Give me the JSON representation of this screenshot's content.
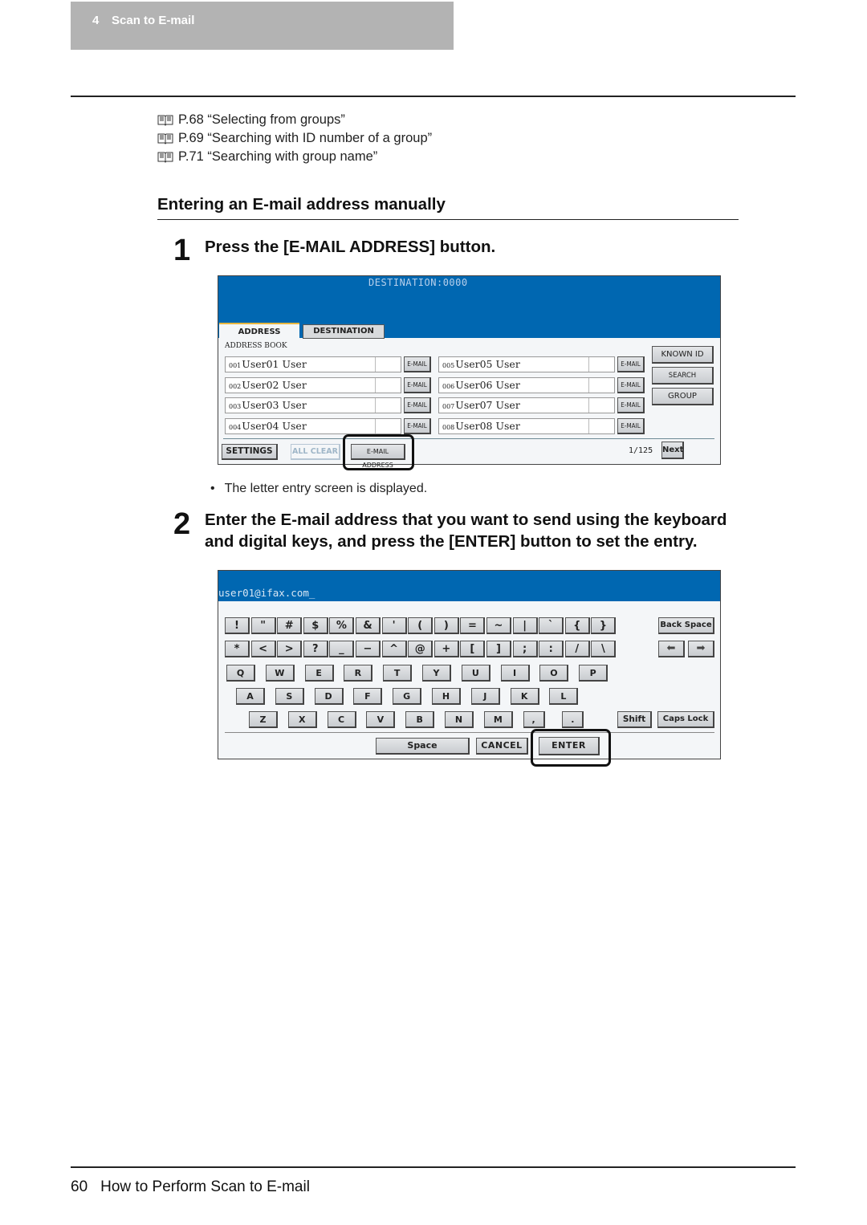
{
  "header": {
    "chapter_number": "4",
    "chapter_title": "Scan to E-mail"
  },
  "references": [
    {
      "icon": "book-icon",
      "text": "P.68 “Selecting from groups”"
    },
    {
      "icon": "book-icon",
      "text": "P.69 “Searching with ID number of a group”"
    },
    {
      "icon": "book-icon",
      "text": "P.71 “Searching with group name”"
    }
  ],
  "section_title": "Entering an E-mail address manually",
  "steps": [
    {
      "number": "1",
      "text": "Press the [E-MAIL ADDRESS] button."
    },
    {
      "number": "2",
      "text_line1": "Enter the E-mail address that you want to send using the keyboard",
      "text_line2": "and digital keys, and press the [ENTER] button to set the entry."
    }
  ],
  "step1_note": "The letter entry screen is displayed.",
  "screen1": {
    "header_text": "DESTINATION:0000",
    "tabs": [
      "ADDRESS",
      "DESTINATION"
    ],
    "address_book_label": "ADDRESS BOOK",
    "entries": [
      {
        "id": "001",
        "name": "User01 User"
      },
      {
        "id": "002",
        "name": "User02 User"
      },
      {
        "id": "003",
        "name": "User03 User"
      },
      {
        "id": "004",
        "name": "User04 User"
      },
      {
        "id": "005",
        "name": "User05 User"
      },
      {
        "id": "006",
        "name": "User06 User"
      },
      {
        "id": "007",
        "name": "User07 User"
      },
      {
        "id": "008",
        "name": "User08 User"
      }
    ],
    "email_button_label": "E-MAIL",
    "side_buttons": [
      "KNOWN ID",
      "SEARCH ADDRESS",
      "GROUP"
    ],
    "bottom_buttons": {
      "settings": "SETTINGS",
      "all_clear": "ALL CLEAR",
      "email_address": "E-MAIL ADDRESS"
    },
    "page_indicator": "1/125",
    "next_label": "Next"
  },
  "screen2": {
    "input_value": "user01@ifax.com_",
    "rows": [
      [
        "!",
        "\"",
        "#",
        "$",
        "%",
        "&",
        "'",
        "(",
        ")",
        "=",
        "~",
        "|",
        "`",
        "{",
        "}"
      ],
      [
        "*",
        "<",
        ">",
        "?",
        "_",
        "−",
        "^",
        "@",
        "+",
        "[",
        "]",
        ";",
        ":",
        "/",
        "\\"
      ],
      [
        "Q",
        "W",
        "E",
        "R",
        "T",
        "Y",
        "U",
        "I",
        "O",
        "P"
      ],
      [
        "A",
        "S",
        "D",
        "F",
        "G",
        "H",
        "J",
        "K",
        "L"
      ],
      [
        "Z",
        "X",
        "C",
        "V",
        "B",
        "N",
        "M",
        ",",
        "."
      ]
    ],
    "backspace_label": "Back Space",
    "left_arrow": "⬅",
    "right_arrow": "➡",
    "shift_label": "Shift",
    "capslock_label": "Caps Lock",
    "space_label": "Space",
    "cancel_label": "CANCEL",
    "enter_label": "ENTER"
  },
  "footer": {
    "page_number": "60",
    "title": "How to Perform Scan to E-mail"
  }
}
